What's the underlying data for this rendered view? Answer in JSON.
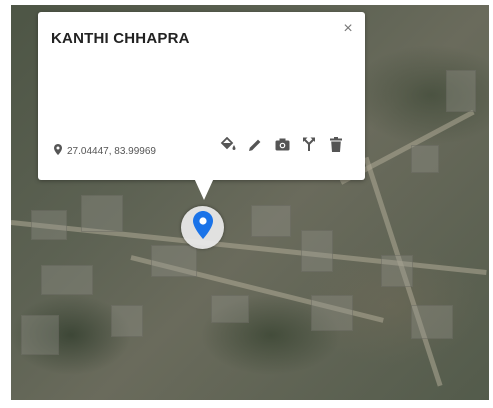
{
  "popup": {
    "title": "KANTHI CHHAPRA",
    "close_label": "×",
    "coordinates": "27.04447, 83.99969"
  },
  "icons": {
    "coordinates": "location-pin-icon",
    "actions": [
      "paint-bucket-icon",
      "pencil-icon",
      "camera-icon",
      "directions-icon",
      "trash-icon"
    ],
    "marker": "map-marker-icon"
  },
  "colors": {
    "marker": "#1a73e8",
    "action_icons": "#555555",
    "title": "#222222"
  }
}
